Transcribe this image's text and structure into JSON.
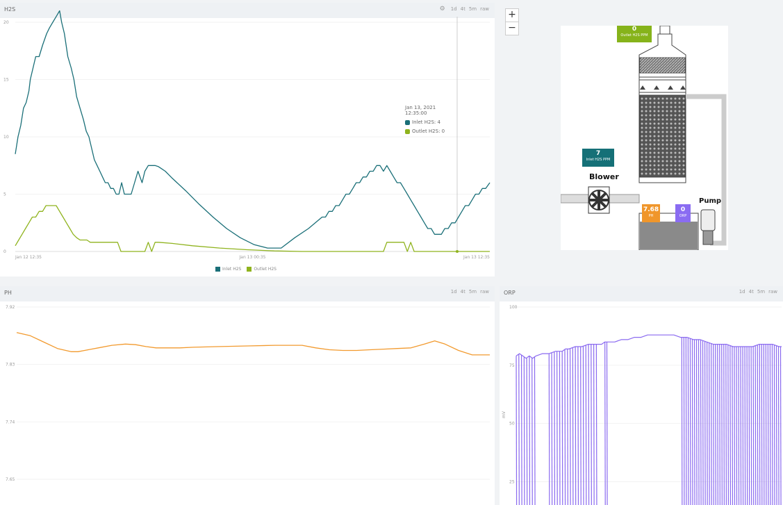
{
  "h2s_panel": {
    "title": "H2S",
    "ranges": [
      "1d",
      "4t",
      "5m",
      "raw"
    ],
    "tooltip": {
      "time": "Jan 13, 2021 12:35:00",
      "inlet": "Inlet H2S:  4",
      "outlet": "Outlet H2S: 0"
    },
    "legend": [
      "Inlet H2S",
      "Outlet H2S"
    ],
    "colors": {
      "inlet": "#1a6f78",
      "outlet": "#8fb31d"
    }
  },
  "ph_panel": {
    "title": "PH",
    "ranges": [
      "1d",
      "4t",
      "5m",
      "raw"
    ],
    "color": "#f29a2e"
  },
  "orp_panel": {
    "title": "ORP",
    "ranges": [
      "1d",
      "4t",
      "5m",
      "raw"
    ],
    "color": "#8a6af0",
    "ylabel": "mV"
  },
  "diagram": {
    "zoom_in": "+",
    "zoom_out": "−",
    "outlet_value": "0",
    "outlet_label": "Outlet H2S PPM",
    "inlet_value": "7",
    "inlet_label": "Inlet H2S PPM",
    "blower": "Blower",
    "pump": "Pump",
    "ph_value": "7.68",
    "ph_label": "PH",
    "orp_value": "0",
    "orp_label": "ORP",
    "colors": {
      "outlet": "#86b31a",
      "inlet": "#157077",
      "ph": "#f0962b",
      "orp": "#8a6cf2"
    }
  },
  "chart_data": [
    {
      "type": "line",
      "title": "H2S",
      "x_ticks": [
        "Jan 12 12:35",
        "Jan 13 00:35",
        "Jan 13 12:35"
      ],
      "y_ticks": [
        "0",
        "5",
        "10",
        "15",
        "20"
      ],
      "ylim": [
        0,
        20
      ],
      "series": [
        {
          "name": "Inlet H2S",
          "x": [
            0,
            4,
            8,
            12,
            16,
            20,
            22,
            26,
            30,
            35,
            40,
            46,
            50,
            55,
            60,
            65,
            68,
            72,
            77,
            82,
            86,
            90,
            95,
            100,
            104,
            108,
            112,
            116,
            120,
            124,
            128,
            132,
            136,
            140,
            144,
            148,
            152,
            156,
            160,
            165,
            170,
            175,
            180,
            186,
            190,
            195,
            200,
            205,
            210,
            215,
            220,
            225,
            230,
            250,
            270,
            290,
            310,
            330,
            350,
            370,
            390,
            410,
            430,
            440,
            450,
            455,
            460,
            465,
            470,
            475,
            480,
            485,
            490,
            495,
            500,
            505,
            510,
            515,
            520,
            525,
            530,
            535,
            540,
            545,
            550,
            555,
            560,
            565,
            570,
            575,
            580,
            585,
            590,
            595,
            600,
            605,
            610,
            615,
            620,
            625,
            630,
            635,
            640,
            645,
            650,
            655,
            660,
            665,
            670,
            675,
            680,
            685,
            690,
            696
          ],
          "y": [
            8.5,
            10,
            11,
            12.5,
            13,
            14,
            15,
            16,
            17,
            17,
            18,
            19,
            19.5,
            20,
            20.5,
            21,
            20,
            19,
            17,
            16,
            15,
            13.5,
            12.5,
            11.5,
            10.5,
            10,
            9,
            8,
            7.5,
            7,
            6.5,
            6,
            6,
            5.5,
            5.5,
            5,
            5,
            6,
            5,
            5,
            5,
            6,
            7,
            6,
            7,
            7.5,
            7.5,
            7.5,
            7.4,
            7.2,
            7.0,
            6.7,
            6.4,
            5.3,
            4.1,
            3.0,
            2.0,
            1.2,
            0.6,
            0.3,
            0.3,
            1.2,
            2.0,
            2.5,
            3,
            3,
            3.5,
            3.5,
            4,
            4,
            4.5,
            5,
            5,
            5.5,
            6,
            6,
            6.5,
            6.5,
            7,
            7,
            7.5,
            7.5,
            7,
            7.5,
            7,
            6.5,
            6,
            6,
            5.5,
            5,
            4.5,
            4,
            3.5,
            3,
            2.5,
            2,
            2,
            1.5,
            1.5,
            1.5,
            2,
            2,
            2.5,
            2.5,
            3,
            3.5,
            4,
            4,
            4.5,
            5,
            5,
            5.5,
            5.5,
            6
          ]
        },
        {
          "name": "Outlet H2S",
          "x": [
            0,
            5,
            10,
            15,
            20,
            25,
            30,
            35,
            40,
            45,
            50,
            55,
            60,
            65,
            70,
            75,
            80,
            85,
            90,
            95,
            100,
            105,
            110,
            115,
            120,
            125,
            130,
            140,
            150,
            155,
            160,
            175,
            190,
            195,
            200,
            205,
            210,
            230,
            260,
            300,
            340,
            380,
            420,
            440,
            480,
            520,
            540,
            545,
            550,
            560,
            570,
            575,
            580,
            585,
            590,
            600,
            620,
            640,
            660,
            680,
            696
          ],
          "y": [
            0.5,
            1,
            1.5,
            2,
            2.5,
            3,
            3,
            3.5,
            3.5,
            4,
            4,
            4,
            4,
            3.5,
            3,
            2.5,
            2,
            1.5,
            1.2,
            1,
            1,
            1,
            0.8,
            0.8,
            0.8,
            0.8,
            0.8,
            0.8,
            0.8,
            0,
            0,
            0,
            0,
            0.8,
            0,
            0.8,
            0.8,
            0.7,
            0.5,
            0.3,
            0.15,
            0.05,
            0,
            0,
            0,
            0,
            0,
            0.8,
            0.8,
            0.8,
            0.8,
            0,
            0.8,
            0,
            0,
            0,
            0,
            0,
            0,
            0,
            0
          ]
        }
      ]
    },
    {
      "type": "line",
      "title": "PH",
      "y_ticks": [
        "7.92",
        "7.83",
        "7.74",
        "7.65"
      ],
      "series": [
        {
          "name": "PH",
          "x": [
            0,
            20,
            40,
            60,
            80,
            90,
            100,
            120,
            140,
            160,
            175,
            190,
            205,
            220,
            240,
            260,
            300,
            340,
            380,
            420,
            440,
            460,
            480,
            500,
            520,
            540,
            560,
            580,
            600,
            615,
            630,
            650,
            670,
            696
          ],
          "y": [
            7.88,
            7.875,
            7.865,
            7.855,
            7.85,
            7.85,
            7.852,
            7.856,
            7.86,
            7.862,
            7.861,
            7.858,
            7.856,
            7.856,
            7.856,
            7.857,
            7.858,
            7.859,
            7.86,
            7.86,
            7.856,
            7.853,
            7.852,
            7.852,
            7.853,
            7.854,
            7.855,
            7.856,
            7.862,
            7.867,
            7.862,
            7.852,
            7.845,
            7.845
          ]
        }
      ]
    },
    {
      "type": "line",
      "title": "ORP",
      "ylabel": "mV",
      "y_ticks": [
        "100",
        "75",
        "50",
        "25"
      ],
      "series": [
        {
          "name": "ORP",
          "x": [
            0,
            5,
            10,
            15,
            20,
            25,
            30,
            40,
            50,
            60,
            70,
            75,
            80,
            90,
            100,
            110,
            120,
            130,
            135,
            140,
            150,
            160,
            170,
            180,
            190,
            200,
            210,
            220,
            230,
            240,
            250,
            255,
            260,
            270,
            280,
            290,
            300,
            310,
            320,
            330,
            340,
            350,
            360,
            370,
            380,
            390,
            400,
            404
          ],
          "y": [
            79,
            80,
            79,
            78,
            79,
            78,
            79,
            80,
            80,
            81,
            81,
            82,
            82,
            83,
            83,
            84,
            84,
            84,
            85,
            85,
            85,
            86,
            86,
            87,
            87,
            88,
            88,
            88,
            88,
            88,
            87,
            87,
            87,
            86,
            86,
            85,
            84,
            84,
            84,
            83,
            83,
            83,
            83,
            84,
            84,
            84,
            83,
            83
          ]
        }
      ]
    }
  ]
}
